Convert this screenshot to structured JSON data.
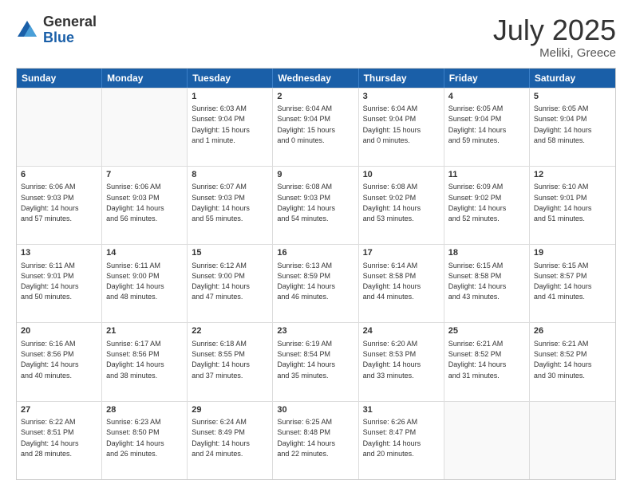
{
  "logo": {
    "general": "General",
    "blue": "Blue"
  },
  "title": {
    "month": "July 2025",
    "location": "Meliki, Greece"
  },
  "calendar": {
    "headers": [
      "Sunday",
      "Monday",
      "Tuesday",
      "Wednesday",
      "Thursday",
      "Friday",
      "Saturday"
    ],
    "rows": [
      [
        {
          "day": "",
          "text": ""
        },
        {
          "day": "",
          "text": ""
        },
        {
          "day": "1",
          "text": "Sunrise: 6:03 AM\nSunset: 9:04 PM\nDaylight: 15 hours\nand 1 minute."
        },
        {
          "day": "2",
          "text": "Sunrise: 6:04 AM\nSunset: 9:04 PM\nDaylight: 15 hours\nand 0 minutes."
        },
        {
          "day": "3",
          "text": "Sunrise: 6:04 AM\nSunset: 9:04 PM\nDaylight: 15 hours\nand 0 minutes."
        },
        {
          "day": "4",
          "text": "Sunrise: 6:05 AM\nSunset: 9:04 PM\nDaylight: 14 hours\nand 59 minutes."
        },
        {
          "day": "5",
          "text": "Sunrise: 6:05 AM\nSunset: 9:04 PM\nDaylight: 14 hours\nand 58 minutes."
        }
      ],
      [
        {
          "day": "6",
          "text": "Sunrise: 6:06 AM\nSunset: 9:03 PM\nDaylight: 14 hours\nand 57 minutes."
        },
        {
          "day": "7",
          "text": "Sunrise: 6:06 AM\nSunset: 9:03 PM\nDaylight: 14 hours\nand 56 minutes."
        },
        {
          "day": "8",
          "text": "Sunrise: 6:07 AM\nSunset: 9:03 PM\nDaylight: 14 hours\nand 55 minutes."
        },
        {
          "day": "9",
          "text": "Sunrise: 6:08 AM\nSunset: 9:03 PM\nDaylight: 14 hours\nand 54 minutes."
        },
        {
          "day": "10",
          "text": "Sunrise: 6:08 AM\nSunset: 9:02 PM\nDaylight: 14 hours\nand 53 minutes."
        },
        {
          "day": "11",
          "text": "Sunrise: 6:09 AM\nSunset: 9:02 PM\nDaylight: 14 hours\nand 52 minutes."
        },
        {
          "day": "12",
          "text": "Sunrise: 6:10 AM\nSunset: 9:01 PM\nDaylight: 14 hours\nand 51 minutes."
        }
      ],
      [
        {
          "day": "13",
          "text": "Sunrise: 6:11 AM\nSunset: 9:01 PM\nDaylight: 14 hours\nand 50 minutes."
        },
        {
          "day": "14",
          "text": "Sunrise: 6:11 AM\nSunset: 9:00 PM\nDaylight: 14 hours\nand 48 minutes."
        },
        {
          "day": "15",
          "text": "Sunrise: 6:12 AM\nSunset: 9:00 PM\nDaylight: 14 hours\nand 47 minutes."
        },
        {
          "day": "16",
          "text": "Sunrise: 6:13 AM\nSunset: 8:59 PM\nDaylight: 14 hours\nand 46 minutes."
        },
        {
          "day": "17",
          "text": "Sunrise: 6:14 AM\nSunset: 8:58 PM\nDaylight: 14 hours\nand 44 minutes."
        },
        {
          "day": "18",
          "text": "Sunrise: 6:15 AM\nSunset: 8:58 PM\nDaylight: 14 hours\nand 43 minutes."
        },
        {
          "day": "19",
          "text": "Sunrise: 6:15 AM\nSunset: 8:57 PM\nDaylight: 14 hours\nand 41 minutes."
        }
      ],
      [
        {
          "day": "20",
          "text": "Sunrise: 6:16 AM\nSunset: 8:56 PM\nDaylight: 14 hours\nand 40 minutes."
        },
        {
          "day": "21",
          "text": "Sunrise: 6:17 AM\nSunset: 8:56 PM\nDaylight: 14 hours\nand 38 minutes."
        },
        {
          "day": "22",
          "text": "Sunrise: 6:18 AM\nSunset: 8:55 PM\nDaylight: 14 hours\nand 37 minutes."
        },
        {
          "day": "23",
          "text": "Sunrise: 6:19 AM\nSunset: 8:54 PM\nDaylight: 14 hours\nand 35 minutes."
        },
        {
          "day": "24",
          "text": "Sunrise: 6:20 AM\nSunset: 8:53 PM\nDaylight: 14 hours\nand 33 minutes."
        },
        {
          "day": "25",
          "text": "Sunrise: 6:21 AM\nSunset: 8:52 PM\nDaylight: 14 hours\nand 31 minutes."
        },
        {
          "day": "26",
          "text": "Sunrise: 6:21 AM\nSunset: 8:52 PM\nDaylight: 14 hours\nand 30 minutes."
        }
      ],
      [
        {
          "day": "27",
          "text": "Sunrise: 6:22 AM\nSunset: 8:51 PM\nDaylight: 14 hours\nand 28 minutes."
        },
        {
          "day": "28",
          "text": "Sunrise: 6:23 AM\nSunset: 8:50 PM\nDaylight: 14 hours\nand 26 minutes."
        },
        {
          "day": "29",
          "text": "Sunrise: 6:24 AM\nSunset: 8:49 PM\nDaylight: 14 hours\nand 24 minutes."
        },
        {
          "day": "30",
          "text": "Sunrise: 6:25 AM\nSunset: 8:48 PM\nDaylight: 14 hours\nand 22 minutes."
        },
        {
          "day": "31",
          "text": "Sunrise: 6:26 AM\nSunset: 8:47 PM\nDaylight: 14 hours\nand 20 minutes."
        },
        {
          "day": "",
          "text": ""
        },
        {
          "day": "",
          "text": ""
        }
      ]
    ]
  }
}
